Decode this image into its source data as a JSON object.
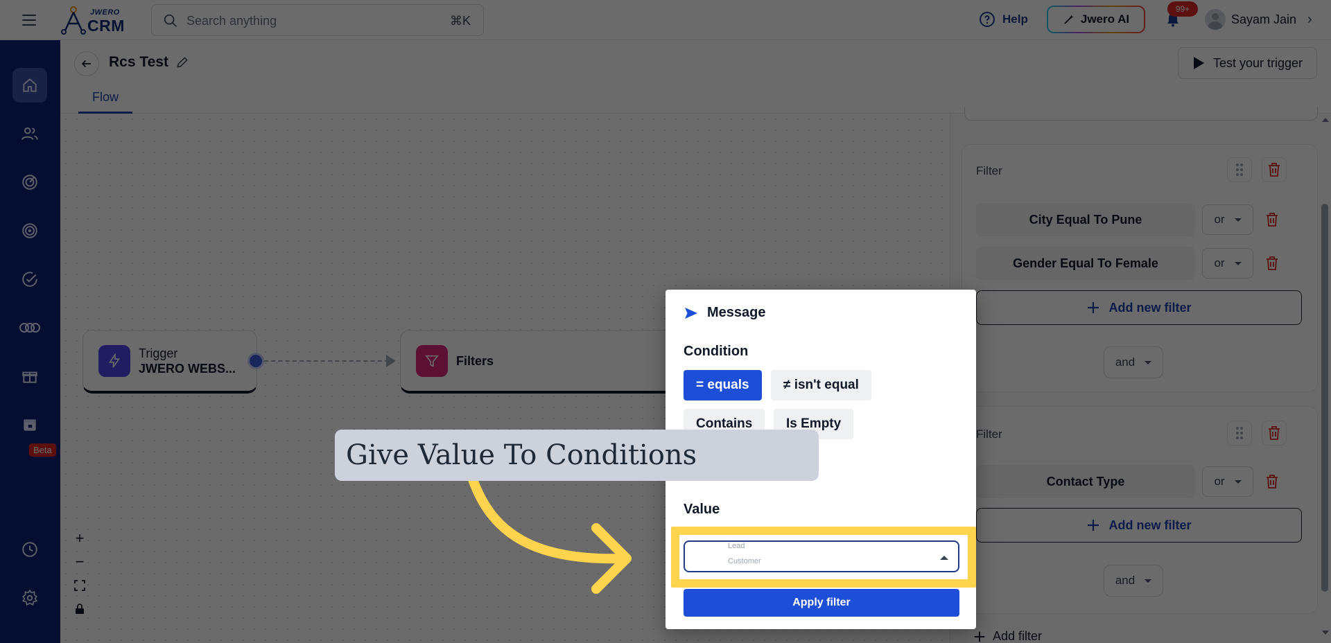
{
  "topbar": {
    "logo_top": "JWERO",
    "logo_main": "CRM",
    "search_placeholder": "Search anything",
    "search_shortcut": "⌘K",
    "help_label": "Help",
    "ai_label": "Jwero AI",
    "notification_count": "99+",
    "user_name": "Sayam Jain"
  },
  "sidebar": {
    "items": [
      {
        "icon": "home-icon",
        "active": true
      },
      {
        "icon": "users-icon"
      },
      {
        "icon": "radar-icon"
      },
      {
        "icon": "target-icon"
      },
      {
        "icon": "check-circle-icon"
      },
      {
        "icon": "infinity-icon"
      },
      {
        "icon": "gift-icon"
      },
      {
        "icon": "calendar-icon"
      }
    ],
    "beta_label": "Beta",
    "bottom_items": [
      {
        "icon": "clock-icon"
      },
      {
        "icon": "settings-icon"
      }
    ]
  },
  "subheader": {
    "title": "Rcs Test",
    "test_button": "Test your trigger",
    "tabs": [
      {
        "label": "Flow",
        "active": true
      }
    ]
  },
  "canvas": {
    "trigger_node": {
      "title": "Trigger",
      "subtitle": "JWERO WEBS..."
    },
    "filters_node": {
      "title": "Filters"
    },
    "zoom_controls": [
      "+",
      "−",
      "⛶",
      "🔒"
    ]
  },
  "filter_panel": {
    "groups": [
      {
        "title": "Filter",
        "rows": [
          {
            "label": "City Equal To Pune",
            "operator": "or"
          },
          {
            "label": "Gender Equal To Female",
            "operator": "or"
          }
        ],
        "add_label": "Add new filter",
        "join": "and"
      },
      {
        "title": "Filter",
        "rows": [
          {
            "label": "Contact Type",
            "operator": "or"
          }
        ],
        "add_label": "Add new filter",
        "join": "and"
      }
    ],
    "add_filter_label": "Add filter"
  },
  "popover": {
    "title": "Message",
    "condition_label": "Condition",
    "conditions": [
      "= equals",
      "≠ isn't equal",
      "Contains",
      "Is Empty"
    ],
    "active_condition": "= equals",
    "value_label": "Value",
    "value_options_preview": [
      "Lead",
      "Customer"
    ],
    "apply_label": "Apply filter"
  },
  "tutorial": {
    "callout_text": "Give Value To Conditions",
    "highlight_color": "#fcd34d"
  },
  "colors": {
    "sidebar_bg": "#0d2372",
    "primary": "#1d4ed8",
    "danger": "#dc2626"
  }
}
